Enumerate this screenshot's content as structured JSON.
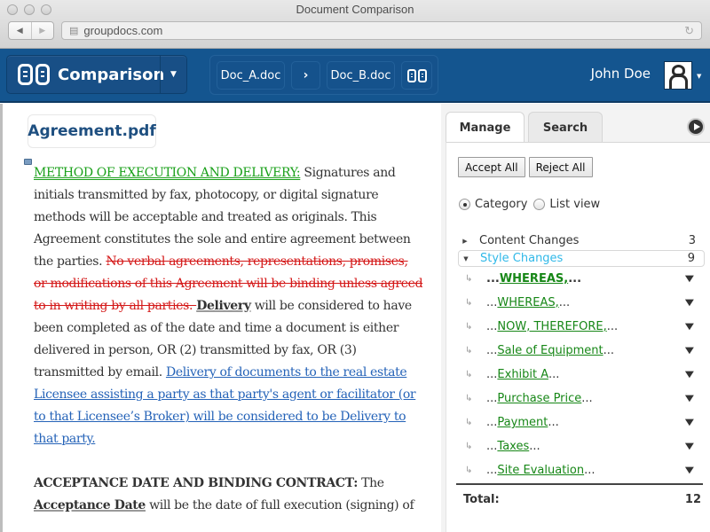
{
  "window": {
    "title": "Document Comparison"
  },
  "browser": {
    "url": "groupdocs.com"
  },
  "header": {
    "brand": "Comparison",
    "doc_a": "Doc_A.doc",
    "arrow": "›",
    "doc_b": "Doc_B.doc",
    "user_name": "John Doe"
  },
  "document": {
    "file_name": "Agreement.pdf",
    "paragraph1": {
      "heading_inserted": "METHOD OF EXECUTION AND DELIVERY:",
      "text1": " Signatures and initials transmitted by fax, photocopy, or digital signature methods will be acceptable and treated as originals. This Agreement constitutes the sole and entire agreement between the parties. ",
      "deleted": "No verbal agreements, representations, promises, or modifications of this Agreement will be binding unless agreed to in writing by all parties. ",
      "style_changed": "Delivery",
      "text2": " will be considered to have been completed as of the date and time a document is either delivered in person, OR (2) transmitted by fax, OR (3) transmitted by email. ",
      "inserted": "Delivery of documents to the real estate Licensee assisting a party as that party's agent or facilitator (or to that Licensee’s Broker) will be considered to be Delivery to that party."
    },
    "paragraph2": {
      "heading": "ACCEPTANCE DATE AND BINDING CONTRACT:",
      "text1": " The ",
      "style_changed": "Acceptance Date",
      "text2": " will be the date of full execution (signing) of"
    }
  },
  "panel": {
    "tabs": [
      {
        "label": "Manage",
        "active": true
      },
      {
        "label": "Search",
        "active": false
      }
    ],
    "accept_all": "Accept All",
    "reject_all": "Reject All",
    "view_modes": [
      {
        "label": "Category",
        "selected": true
      },
      {
        "label": "List view",
        "selected": false
      }
    ],
    "categories": [
      {
        "label": "Content Changes",
        "count": "3",
        "expanded": false
      },
      {
        "label": "Style Changes",
        "count": "9",
        "expanded": true
      }
    ],
    "style_items": [
      {
        "prefix": "...",
        "text": "WHEREAS,",
        "suffix": "..."
      },
      {
        "prefix": "...",
        "text": "WHEREAS,",
        "suffix": "..."
      },
      {
        "prefix": "...",
        "text": "NOW, THEREFORE,",
        "suffix": "..."
      },
      {
        "prefix": "...",
        "text": "Sale of Equipment",
        "suffix": "..."
      },
      {
        "prefix": "...",
        "text": "Exhibit A",
        "suffix": "..."
      },
      {
        "prefix": "...",
        "text": "Purchase Price",
        "suffix": "..."
      },
      {
        "prefix": "...",
        "text": "Payment",
        "suffix": "..."
      },
      {
        "prefix": "...",
        "text": "Taxes",
        "suffix": "..."
      },
      {
        "prefix": "...",
        "text": "Site Evaluation",
        "suffix": "..."
      }
    ],
    "total_label": "Total:",
    "total_value": "12"
  },
  "colors": {
    "header_bg": "#14558f",
    "inserted_green": "#1aa01a",
    "deleted_red": "#d41818",
    "inserted_blue": "#2563b8",
    "style_category": "#2fb8e8",
    "item_link_green": "#178717"
  }
}
